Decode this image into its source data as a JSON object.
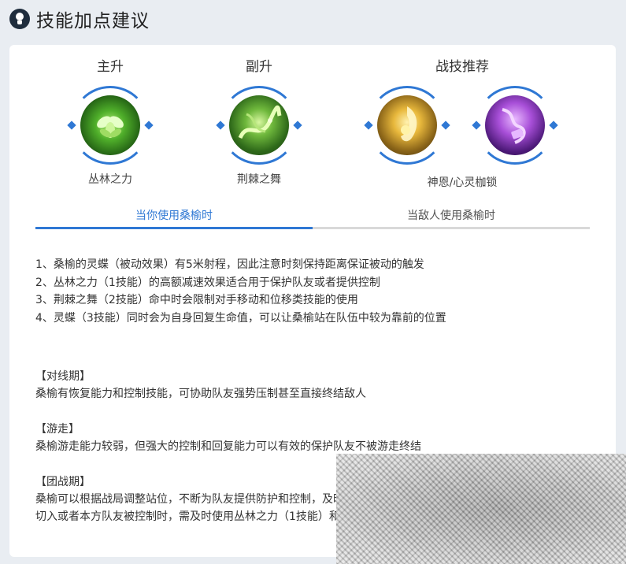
{
  "header": {
    "title": "技能加点建议",
    "icon": "lightbulb-icon"
  },
  "groups": {
    "main": {
      "title": "主升",
      "skill": "丛林之力",
      "icon": "jungle-power-icon"
    },
    "sub": {
      "title": "副升",
      "skill": "荆棘之舞",
      "icon": "thorn-dance-icon"
    },
    "battle": {
      "title": "战技推荐",
      "skill": "神恩/心灵枷锁",
      "icons": [
        "grace-icon",
        "mind-shackle-icon"
      ]
    }
  },
  "tabs": {
    "active": "当你使用桑榆时",
    "inactive": "当敌人使用桑榆时"
  },
  "tips": [
    "1、桑榆的灵蝶（被动效果）有5米射程，因此注意时刻保持距离保证被动的触发",
    "2、丛林之力（1技能）的高额减速效果适合用于保护队友或者提供控制",
    "3、荆棘之舞（2技能）命中时会限制对手移动和位移类技能的使用",
    "4、灵蝶（3技能）同时会为自身回复生命值，可以让桑榆站在队伍中较为靠前的位置"
  ],
  "sections": [
    {
      "head": "【对线期】",
      "body": "桑榆有恢复能力和控制技能，可协助队友强势压制甚至直接终结敌人"
    },
    {
      "head": "【游走】",
      "body": "桑榆游走能力较弱，但强大的控制和回复能力可以有效的保护队友不被游走终结"
    },
    {
      "head": "【团战期】",
      "body": "桑榆可以根据战局调整站位，不断为队友提供防护和控制，及时保护",
      "body2": "切入或者本方队友被控制时，需及时使用丛林之力（1技能）和"
    }
  ],
  "colors": {
    "accent": "#2f78d4",
    "background": "#e9edf2"
  }
}
